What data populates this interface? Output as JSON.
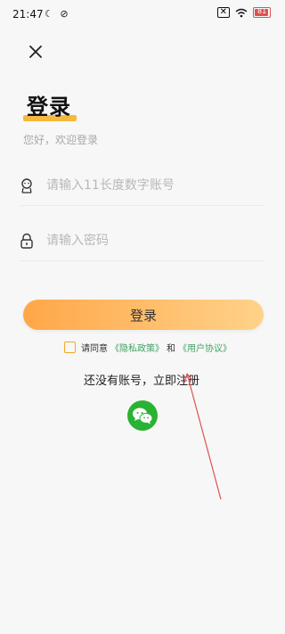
{
  "status_bar": {
    "time": "21:47",
    "battery": "81"
  },
  "header": {
    "title": "登录",
    "subtitle": "您好，欢迎登录"
  },
  "form": {
    "account_placeholder": "请输入11长度数字账号",
    "password_placeholder": "请输入密码",
    "login_label": "登录"
  },
  "agreement": {
    "prefix": "请同意",
    "privacy_link": "《隐私政策》",
    "and": "和",
    "terms_link": "《用户协议》"
  },
  "register_text": "还没有账号，立即注册",
  "icons": {
    "close": "close-icon",
    "account": "user-icon",
    "password": "lock-icon",
    "wechat": "wechat-icon"
  },
  "colors": {
    "accent": "#f5b93d",
    "link": "#3ea363",
    "wechat": "#2ab233",
    "annotation": "#e05050"
  }
}
